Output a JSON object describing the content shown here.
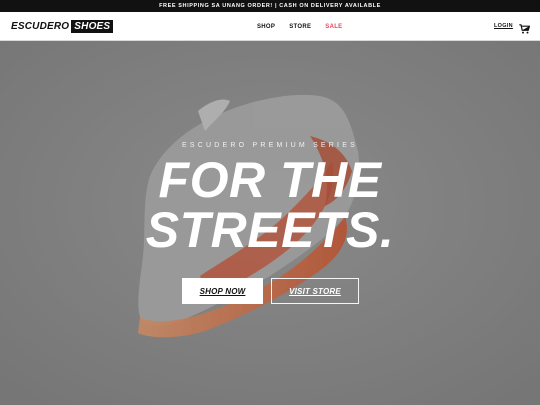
{
  "announcement": "FREE SHIPPING SA UNANG ORDER! | CASH ON DELIVERY AVAILABLE",
  "brand": {
    "part1": "ESCUDERO",
    "part2": "SHOES"
  },
  "nav": {
    "items": [
      {
        "label": "SHOP"
      },
      {
        "label": "STORE"
      },
      {
        "label": "SALE"
      }
    ],
    "login": "LOGIN"
  },
  "icons": {
    "cart": "cart-icon"
  },
  "hero": {
    "eyebrow": "ESCUDERO PREMIUM SERIES",
    "headline_line1": "FOR THE",
    "headline_line2": "STREETS.",
    "primary_button": "SHOP NOW",
    "secondary_button": "VISIT STORE"
  },
  "colors": {
    "sale": "#e3475a",
    "overlay": "#7c7c7c",
    "topbar": "#111111"
  }
}
